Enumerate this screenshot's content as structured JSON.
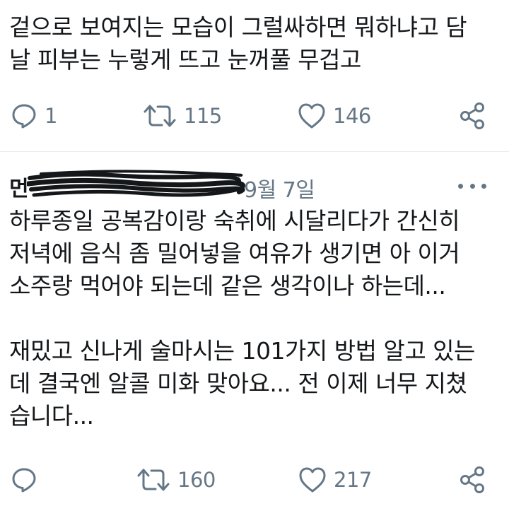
{
  "tweet1": {
    "lines": [
      "겉으로 보여지는 모습이 그럴싸하면 뭐하냐고 담",
      "날 피부는 누렇게 뜨고 눈꺼풀 무겁고"
    ],
    "actions": {
      "reply_count": "1",
      "retweet_count": "115",
      "like_count": "146"
    }
  },
  "tweet2": {
    "author_visible": "먼",
    "date": "9월 7일",
    "lines": [
      "하루종일 공복감이랑 숙취에 시달리다가 간신히",
      "저녁에 음식 좀 밀어넣을 여유가 생기면 아 이거",
      "소주랑 먹어야 되는데 같은 생각이나 하는데..."
    ],
    "lines2": [
      "재밌고 신나게 술마시는 101가지 방법 알고 있는",
      "데 결국엔 알콜 미화 맞아요... 전 이제 너무 지쳤",
      "습니다..."
    ],
    "actions": {
      "retweet_count": "160",
      "like_count": "217"
    }
  },
  "icons": {
    "reply": "reply-icon",
    "retweet": "retweet-icon",
    "like": "heart-icon",
    "share": "share-icon",
    "more": "more-icon"
  },
  "colors": {
    "text": "#14171a",
    "muted": "#657786",
    "divider": "#e6ecf0"
  }
}
